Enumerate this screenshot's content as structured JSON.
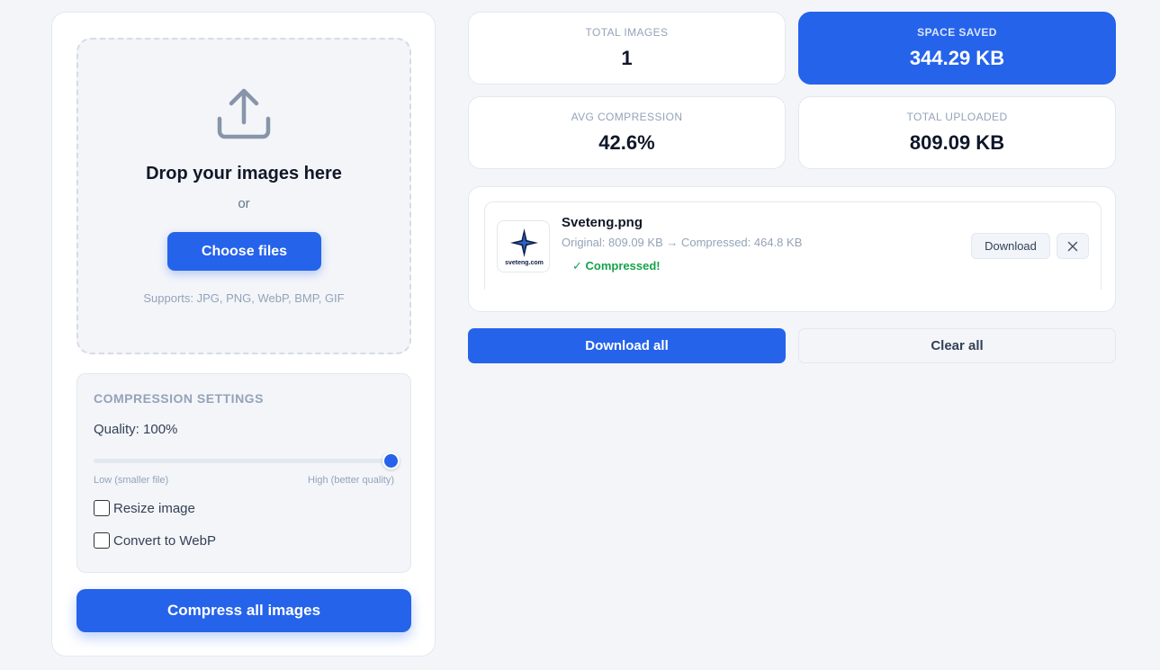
{
  "upload": {
    "title": "Drop your images here",
    "or_text": "or",
    "choose_label": "Choose files",
    "supports_text": "Supports: JPG, PNG, WebP, BMP, GIF"
  },
  "settings": {
    "title": "COMPRESSION SETTINGS",
    "quality_label": "Quality: 100%",
    "quality_value": 100,
    "slider_low": "Low (smaller file)",
    "slider_high": "High (better quality)",
    "resize_label": "Resize image",
    "resize_checked": false,
    "webp_label": "Convert to WebP",
    "webp_checked": false
  },
  "compress_button": "Compress all images",
  "stats": {
    "total_images_label": "TOTAL IMAGES",
    "total_images_value": "1",
    "space_saved_label": "SPACE SAVED",
    "space_saved_value": "344.29 KB",
    "avg_compression_label": "AVG COMPRESSION",
    "avg_compression_value": "42.6%",
    "total_uploaded_label": "TOTAL UPLOADED",
    "total_uploaded_value": "809.09 KB"
  },
  "files": [
    {
      "name": "Sveteng.png",
      "sizes": "Original: 809.09 KB → Compressed: 464.8 KB",
      "status": "✓ Compressed!",
      "thumb_text": "sveteng.com",
      "download_label": "Download",
      "remove_icon": "close-icon"
    }
  ],
  "actions": {
    "download_all": "Download all",
    "clear_all": "Clear all"
  },
  "colors": {
    "accent": "#2563eb",
    "success": "#16a34a",
    "background": "#f3f5f9"
  }
}
